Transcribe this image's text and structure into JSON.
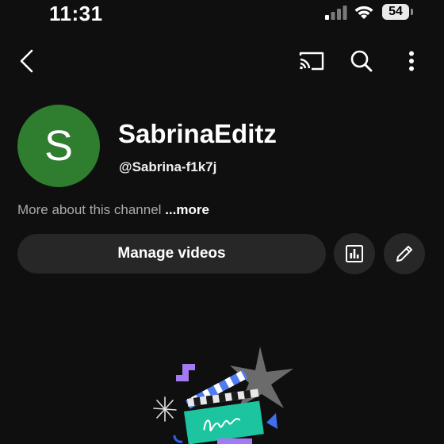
{
  "status_bar": {
    "time": "11:31",
    "battery": "54"
  },
  "app_bar": {
    "icons": [
      "back-icon",
      "cast-icon",
      "search-icon",
      "more-vert-icon"
    ]
  },
  "channel": {
    "avatar_letter": "S",
    "avatar_color": "#2f7d2f",
    "name": "SabrinaEditz",
    "handle": "@Sabrina-f1k7j",
    "about_text": "More about this channel",
    "more_label": "...more"
  },
  "actions": {
    "manage_videos_label": "Manage videos",
    "icons": [
      "analytics-icon",
      "edit-pencil-icon"
    ]
  },
  "colors": {
    "background": "#0f0f0f",
    "button_bg": "#272727",
    "secondary_text": "#aaaaaa"
  }
}
